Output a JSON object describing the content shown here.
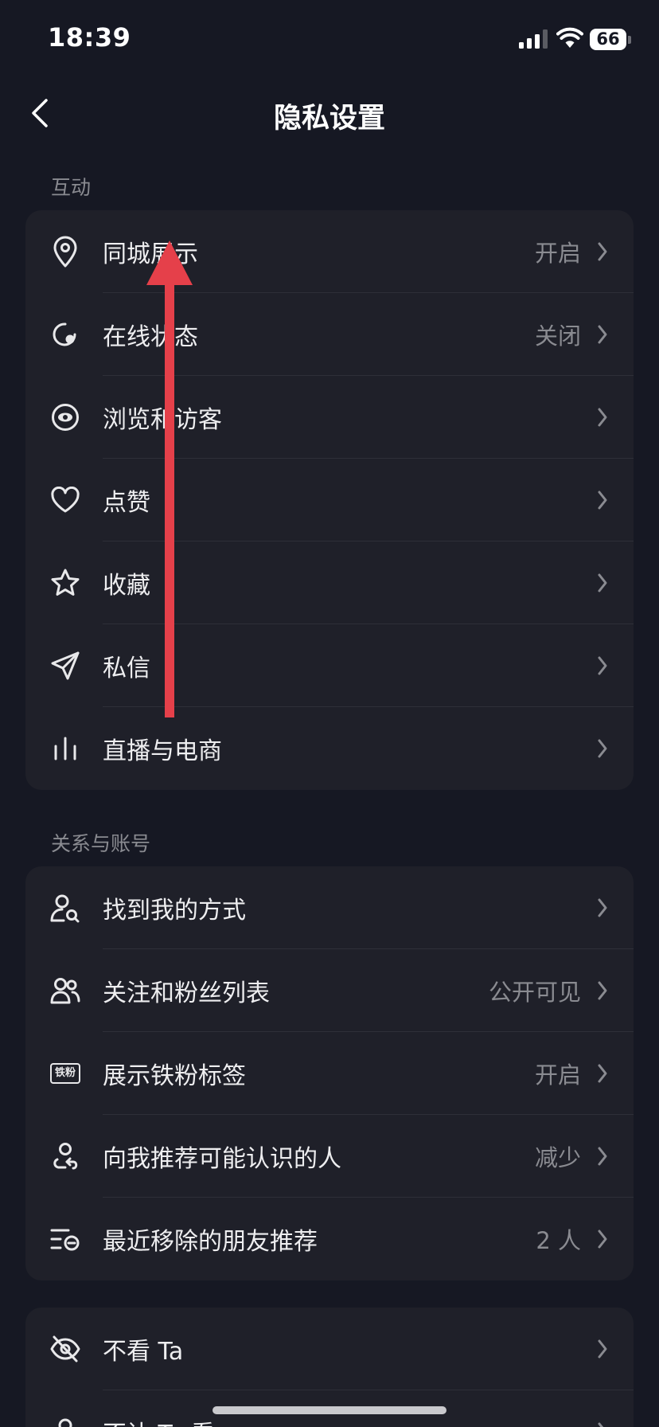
{
  "status_bar": {
    "time": "18:39",
    "battery": "66"
  },
  "nav": {
    "title": "隐私设置"
  },
  "sections": [
    {
      "label": "互动",
      "items": [
        {
          "label": "同城展示",
          "value": "开启",
          "icon": "location-pin-icon"
        },
        {
          "label": "在线状态",
          "value": "关闭",
          "icon": "online-status-icon"
        },
        {
          "label": "浏览和访客",
          "value": "",
          "icon": "eye-icon"
        },
        {
          "label": "点赞",
          "value": "",
          "icon": "heart-icon"
        },
        {
          "label": "收藏",
          "value": "",
          "icon": "star-icon"
        },
        {
          "label": "私信",
          "value": "",
          "icon": "send-icon"
        },
        {
          "label": "直播与电商",
          "value": "",
          "icon": "bars-icon"
        }
      ]
    },
    {
      "label": "关系与账号",
      "items": [
        {
          "label": "找到我的方式",
          "value": "",
          "icon": "user-search-icon"
        },
        {
          "label": "关注和粉丝列表",
          "value": "公开可见",
          "icon": "users-icon"
        },
        {
          "label": "展示铁粉标签",
          "value": "开启",
          "icon": "tiefen-badge-icon",
          "badge_text": "铁粉"
        },
        {
          "label": "向我推荐可能认识的人",
          "value": "减少",
          "icon": "user-recommend-icon"
        },
        {
          "label": "最近移除的朋友推荐",
          "value": "2 人",
          "icon": "removed-list-icon"
        }
      ]
    },
    {
      "label": "",
      "items": [
        {
          "label": "不看 Ta",
          "value": "",
          "icon": "eye-off-icon"
        },
        {
          "label": "不让 Ta 看",
          "value": "",
          "icon": "user-icon"
        }
      ]
    }
  ],
  "colors": {
    "background": "#161823",
    "card": "#1f2029",
    "primary_text": "#eeeef0",
    "secondary_text": "#8a8b91",
    "annotation_arrow": "#e5404a"
  }
}
